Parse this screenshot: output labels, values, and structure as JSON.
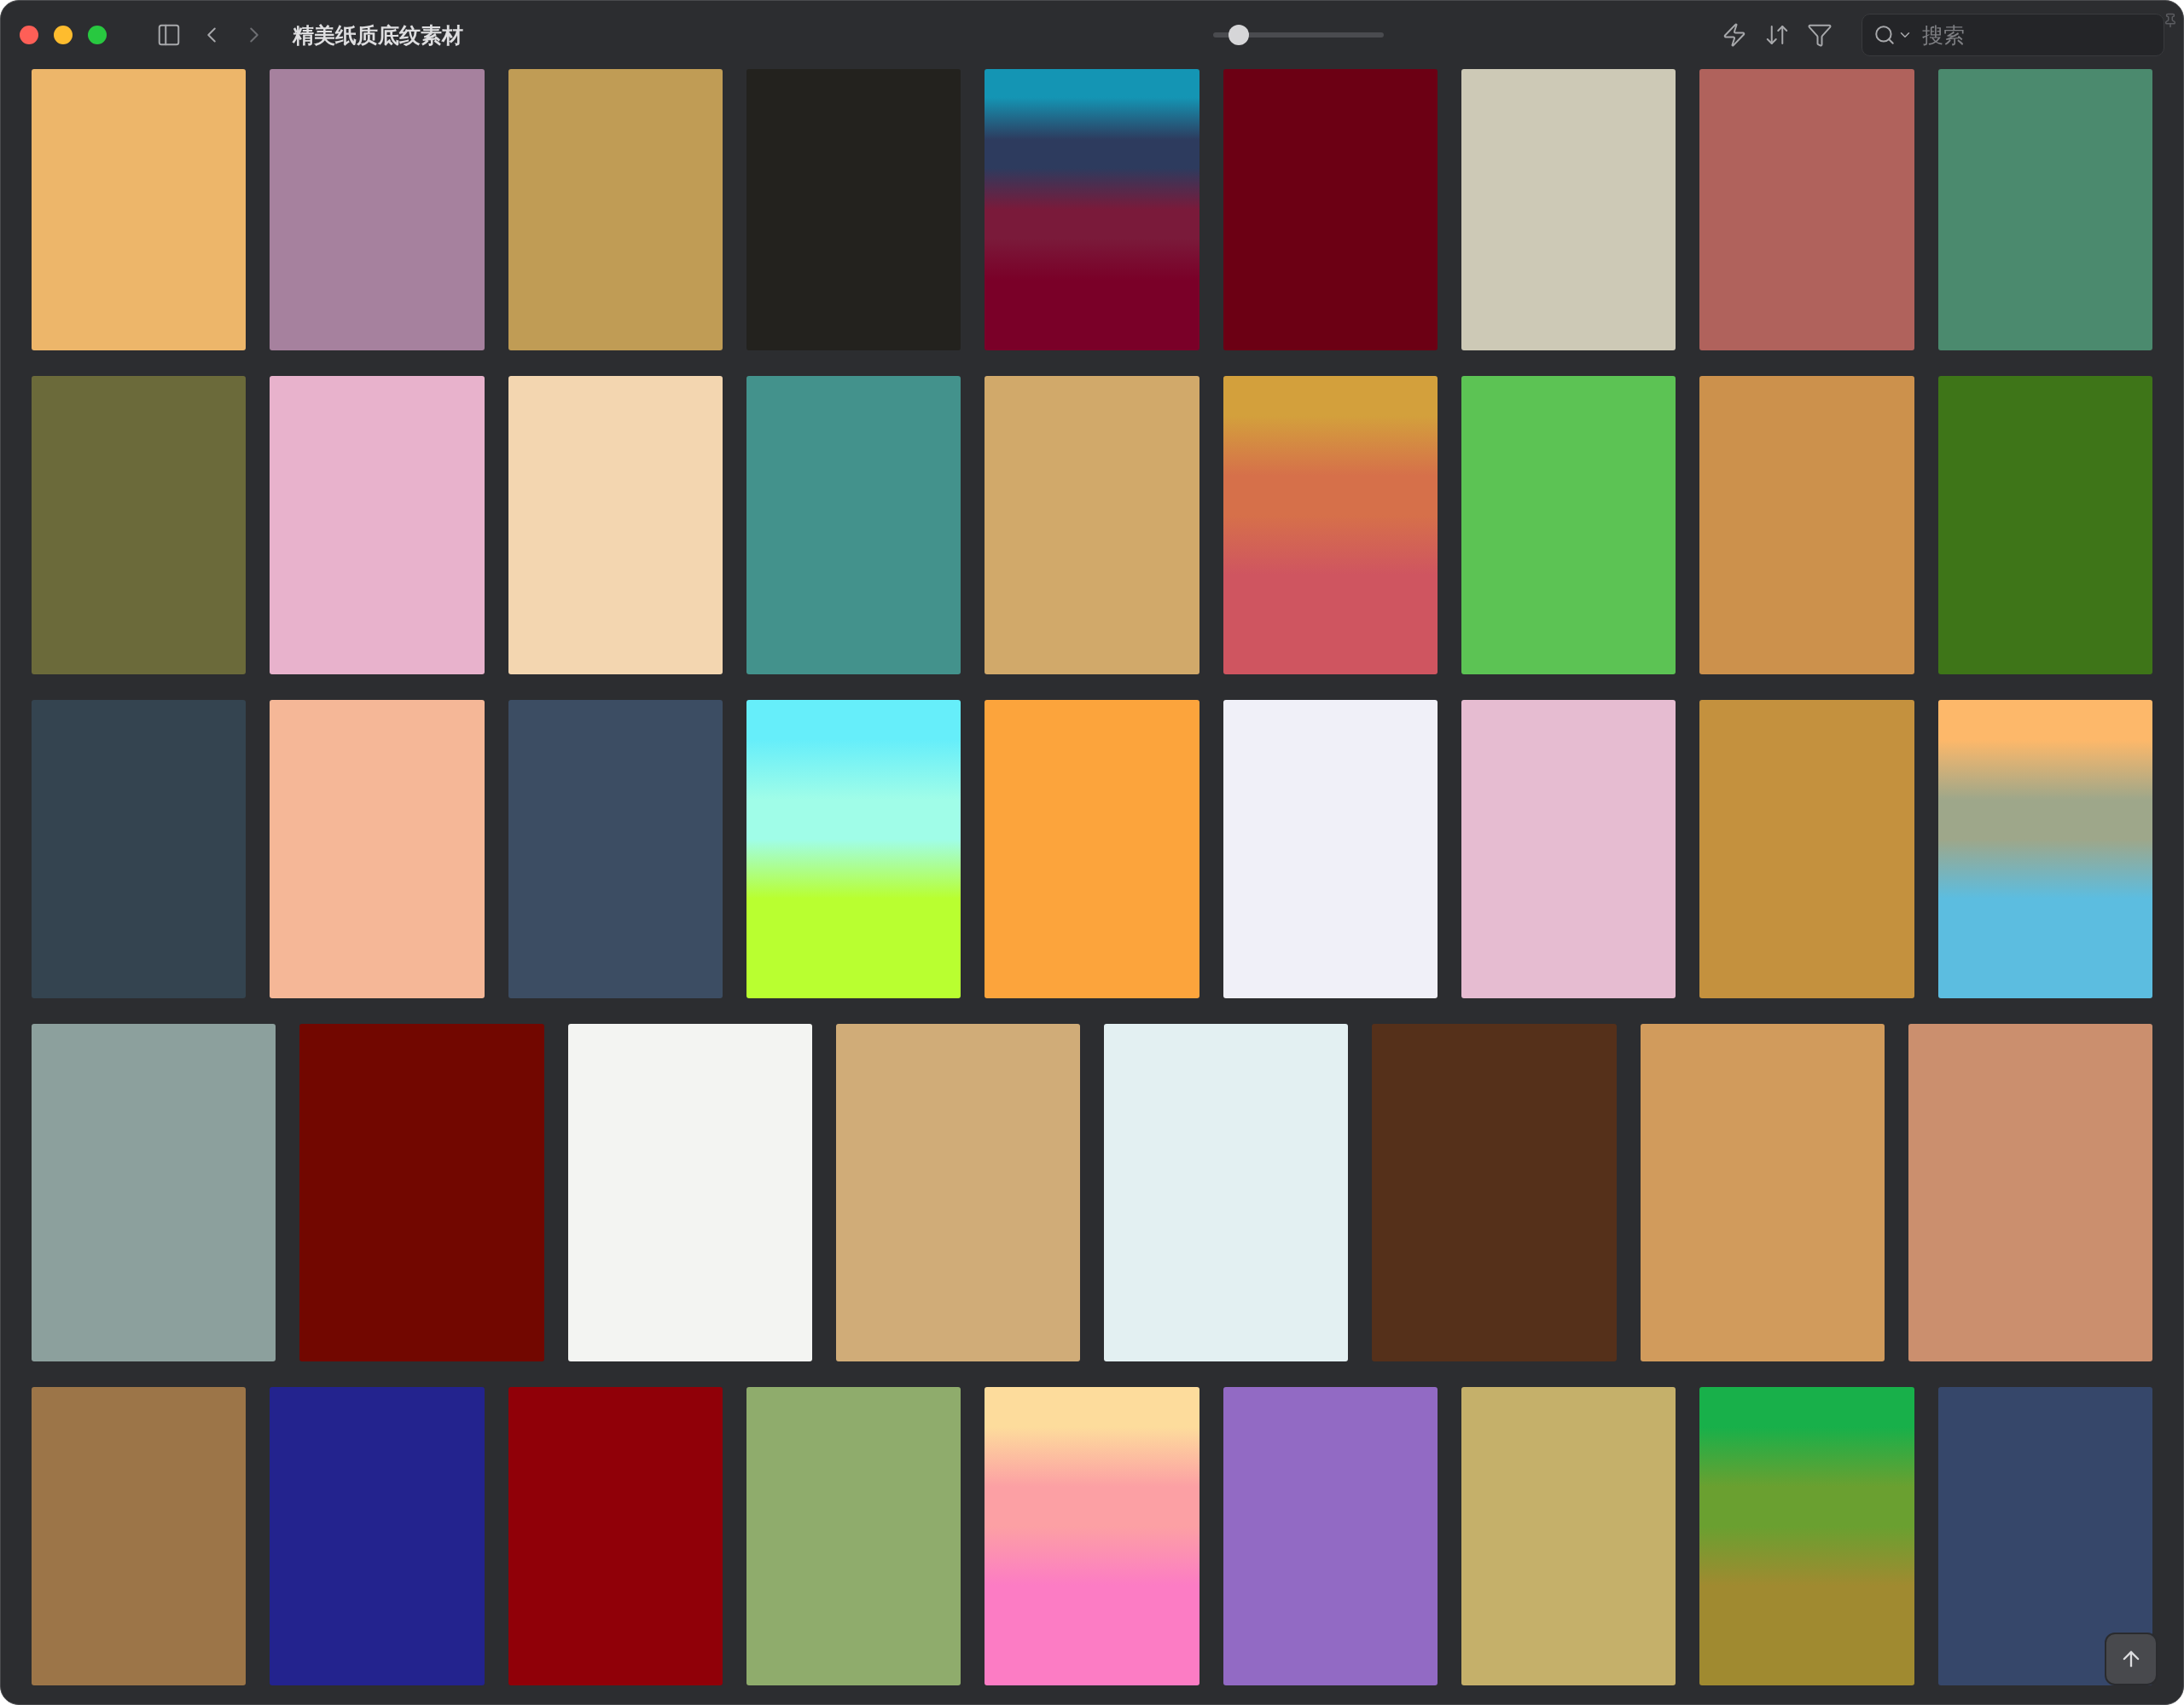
{
  "window": {
    "title": "精美纸质底纹素材"
  },
  "zoom_slider": {
    "level": 0.15
  },
  "search": {
    "placeholder": "搜索"
  },
  "rows": [
    {
      "tiles": [
        {
          "kind": "flat",
          "color": "#edb66a"
        },
        {
          "kind": "flat",
          "color": "#a6819e"
        },
        {
          "kind": "flat",
          "color": "#c09c55"
        },
        {
          "kind": "flat",
          "color": "#23221e"
        },
        {
          "kind": "gradient",
          "stops": [
            {
              "color": "#1495b4"
            },
            {
              "color": "#2d3b5e"
            },
            {
              "color": "#7a1a3a"
            },
            {
              "color": "#7a0028"
            }
          ]
        },
        {
          "kind": "flat",
          "color": "#6c0014"
        },
        {
          "kind": "flat",
          "color": "#cdc9b6"
        },
        {
          "kind": "flat",
          "color": "#b0625c"
        },
        {
          "kind": "flat",
          "color": "#4b8a6e"
        }
      ]
    },
    {
      "tiles": [
        {
          "kind": "flat",
          "color": "#6b6a3a"
        },
        {
          "kind": "flat",
          "color": "#e8b2cc"
        },
        {
          "kind": "flat",
          "color": "#f3d6b0"
        },
        {
          "kind": "flat",
          "color": "#43928c"
        },
        {
          "kind": "flat",
          "color": "#d1a96a"
        },
        {
          "kind": "gradient",
          "stops": [
            {
              "color": "#d3a03c"
            },
            {
              "color": "#d6704a"
            },
            {
              "color": "#cf5560"
            }
          ]
        },
        {
          "kind": "flat",
          "color": "#5cc354"
        },
        {
          "kind": "flat",
          "color": "#cc914c"
        },
        {
          "kind": "flat",
          "color": "#3e7518"
        }
      ]
    },
    {
      "tiles": [
        {
          "kind": "flat",
          "color": "#344450"
        },
        {
          "kind": "flat",
          "color": "#f5b797"
        },
        {
          "kind": "flat",
          "color": "#3c4d63"
        },
        {
          "kind": "gradient",
          "stops": [
            {
              "color": "#66eefa"
            },
            {
              "color": "#a0fde8"
            },
            {
              "color": "#b9ff30"
            }
          ]
        },
        {
          "kind": "flat",
          "color": "#fca43c"
        },
        {
          "kind": "flat",
          "color": "#f0f0f8"
        },
        {
          "kind": "flat",
          "color": "#e6bcd1"
        },
        {
          "kind": "flat",
          "color": "#c4913e"
        },
        {
          "kind": "gradient",
          "stops": [
            {
              "color": "#fdb86a"
            },
            {
              "color": "#9ea78a"
            },
            {
              "color": "#5cbde0"
            }
          ]
        }
      ]
    },
    {
      "tiles": [
        {
          "kind": "flat",
          "color": "#8ca09d"
        },
        {
          "kind": "flat",
          "color": "#720700"
        },
        {
          "kind": "flat",
          "color": "#f3f4f2"
        },
        {
          "kind": "flat",
          "color": "#d0ac78"
        },
        {
          "kind": "flat",
          "color": "#e3f0f2"
        },
        {
          "kind": "flat",
          "color": "#55301a"
        },
        {
          "kind": "flat",
          "color": "#d19b5c"
        },
        {
          "kind": "flat",
          "color": "#cb8f6e"
        }
      ]
    },
    {
      "tiles": [
        {
          "kind": "flat",
          "color": "#9c7548"
        },
        {
          "kind": "flat",
          "color": "#23238e"
        },
        {
          "kind": "flat",
          "color": "#900008"
        },
        {
          "kind": "flat",
          "color": "#8fac6c"
        },
        {
          "kind": "gradient",
          "stops": [
            {
              "color": "#fddc9c"
            },
            {
              "color": "#fca0a4"
            },
            {
              "color": "#fc7cc4"
            }
          ]
        },
        {
          "kind": "flat",
          "color": "#926ac4"
        },
        {
          "kind": "flat",
          "color": "#c5b06a"
        },
        {
          "kind": "gradient",
          "stops": [
            {
              "color": "#18b04a"
            },
            {
              "color": "#6aa030"
            },
            {
              "color": "#a08a30"
            }
          ]
        },
        {
          "kind": "flat",
          "color": "#36476a"
        }
      ]
    }
  ]
}
